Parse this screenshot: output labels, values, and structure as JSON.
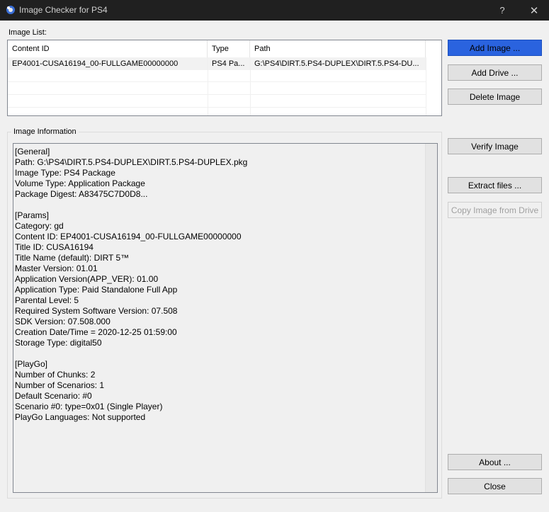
{
  "window": {
    "title": "Image Checker for PS4",
    "help_label": "?",
    "close_label": "✕"
  },
  "image_list": {
    "label": "Image List:",
    "columns": [
      "Content ID",
      "Type",
      "Path"
    ],
    "rows": [
      [
        "EP4001-CUSA16194_00-FULLGAME00000000",
        "PS4 Pa...",
        "G:\\PS4\\DIRT.5.PS4-DUPLEX\\DIRT.5.PS4-DU..."
      ]
    ]
  },
  "image_info": {
    "label": "Image Information",
    "lines": [
      "[General]",
      "Path: G:\\PS4\\DIRT.5.PS4-DUPLEX\\DIRT.5.PS4-DUPLEX.pkg",
      "Image Type: PS4 Package",
      "Volume Type: Application Package",
      "Package Digest: A83475C7D0D8...",
      "",
      "[Params]",
      "Category: gd",
      "Content ID: EP4001-CUSA16194_00-FULLGAME00000000",
      "Title ID: CUSA16194",
      "Title Name (default): DIRT 5™",
      "Master Version: 01.01",
      "Application Version(APP_VER): 01.00",
      "Application Type: Paid Standalone Full App",
      "Parental Level: 5",
      "Required System Software Version: 07.508",
      "SDK Version: 07.508.000",
      "Creation Date/Time = 2020-12-25 01:59:00",
      "Storage Type: digital50",
      "",
      "[PlayGo]",
      "Number of Chunks: 2",
      "Number of Scenarios: 1",
      "Default Scenario: #0",
      "Scenario #0: type=0x01 (Single Player)",
      "PlayGo Languages: Not supported"
    ]
  },
  "buttons": {
    "add_image": "Add Image ...",
    "add_drive": "Add Drive ...",
    "delete_image": "Delete Image",
    "verify_image": "Verify Image",
    "extract_files": "Extract files ...",
    "copy_image_from_drive": "Copy Image from Drive",
    "about": "About ...",
    "close": "Close"
  },
  "colors": {
    "titlebar": "#202020",
    "primary_button": "#2a63df",
    "window_bg": "#f0f0f0"
  }
}
